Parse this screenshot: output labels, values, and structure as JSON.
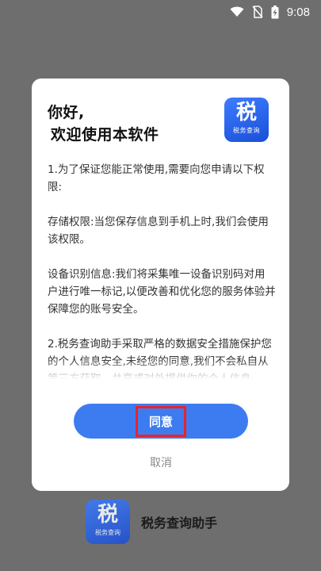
{
  "status_bar": {
    "time": "9:08",
    "icons": [
      "wifi-icon",
      "no-sim-icon",
      "battery-charging-icon"
    ]
  },
  "dialog": {
    "greeting_line1": "你好,",
    "greeting_line2": "欢迎使用本软件",
    "logo": {
      "char": "税",
      "subtitle": "税务查询"
    },
    "paragraphs": [
      "1.为了保证您能正常使用,需要向您申请以下权限:",
      "存储权限:当您保存信息到手机上时,我们会使用该权限。",
      "设备识别信息:我们将采集唯一设备识别码对用户进行唯一标记,以便改善和优化您的服务体验并保障您的账号安全。",
      "2.税务查询助手采取严格的数据安全措施保护您的个人信息安全,未经您的同意,我们不会私自从第三方获取、共享或对外提供你的个人信息。"
    ],
    "agree_label": "同意",
    "cancel_label": "取消"
  },
  "brand": {
    "logo": {
      "char": "税",
      "subtitle": "税务查询"
    },
    "app_name": "税务查询助手"
  },
  "colors": {
    "overlay": "#6e6e6e",
    "primary": "#3d7cf0",
    "highlight_border": "#e8232b",
    "cancel_text": "#8a8a8a"
  }
}
